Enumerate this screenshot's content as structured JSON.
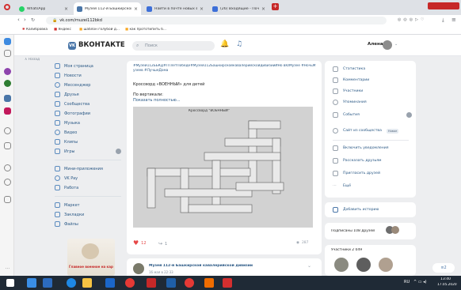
{
  "browser": {
    "tabs": [
      {
        "title": "WhatsApp"
      },
      {
        "title": "Музей 112-й Башкирской"
      },
      {
        "title": "Найти в почте новых в эл."
      },
      {
        "title": "(26) Входящие - Почта М."
      }
    ],
    "url": "vk.com/muzei112bkd",
    "bookmarks": [
      "Калибровка",
      "Яндекс",
      "шаблон голубой д...",
      "как прототипить б..."
    ]
  },
  "vk": {
    "brand": "ВКОНТАКТЕ",
    "search_placeholder": "Поиск",
    "user": "Алена",
    "menu": [
      "Моя страница",
      "Новости",
      "Мессенджер",
      "Друзья",
      "Сообщества",
      "Фотографии",
      "Музыка",
      "Видео",
      "Клипы",
      "Игры",
      "Мини-приложения",
      "VK Pay",
      "Работа",
      "Маркет",
      "Закладки",
      "Файлы"
    ],
    "games_badge": "",
    "back_label": "Назад",
    "banner_text": "Главное военное на карте..."
  },
  "post": {
    "hashtags": "#Музей112ББКД#ПТлетПобеде#Музей112БашкирскойкавалерийскойдивизииИНо вЮМузее #НочьМузеев #ЛучшеДома",
    "title": "Кроссворд «ВОЕННЫЙ» для детей",
    "sub1": "По вертикали:",
    "sub2": "Показать полностью...",
    "image_caption": "Кроссворд \"ВОЕННЫЙ\"",
    "likes": "12",
    "shares": "1",
    "views": "287"
  },
  "post2": {
    "title": "Музей 112-й Башкирской кавалерийской дивизии",
    "time": "16 мая в 22:33"
  },
  "right": {
    "items": [
      "Статистика",
      "Комментарии",
      "Участники",
      "Упоминания",
      "События",
      "Сайт из сообщества",
      "Включить уведомления",
      "Рассказать друзьям",
      "Пригласить друзей",
      "Ещё"
    ],
    "new_badge": "Новое",
    "add_story": "Добавить историю",
    "subscriptions": "Подписаны 108 друзей",
    "members": "Участники 2 049"
  },
  "taskbar": {
    "lang": "RU",
    "time": "13:40",
    "date": "17.05.2020"
  }
}
